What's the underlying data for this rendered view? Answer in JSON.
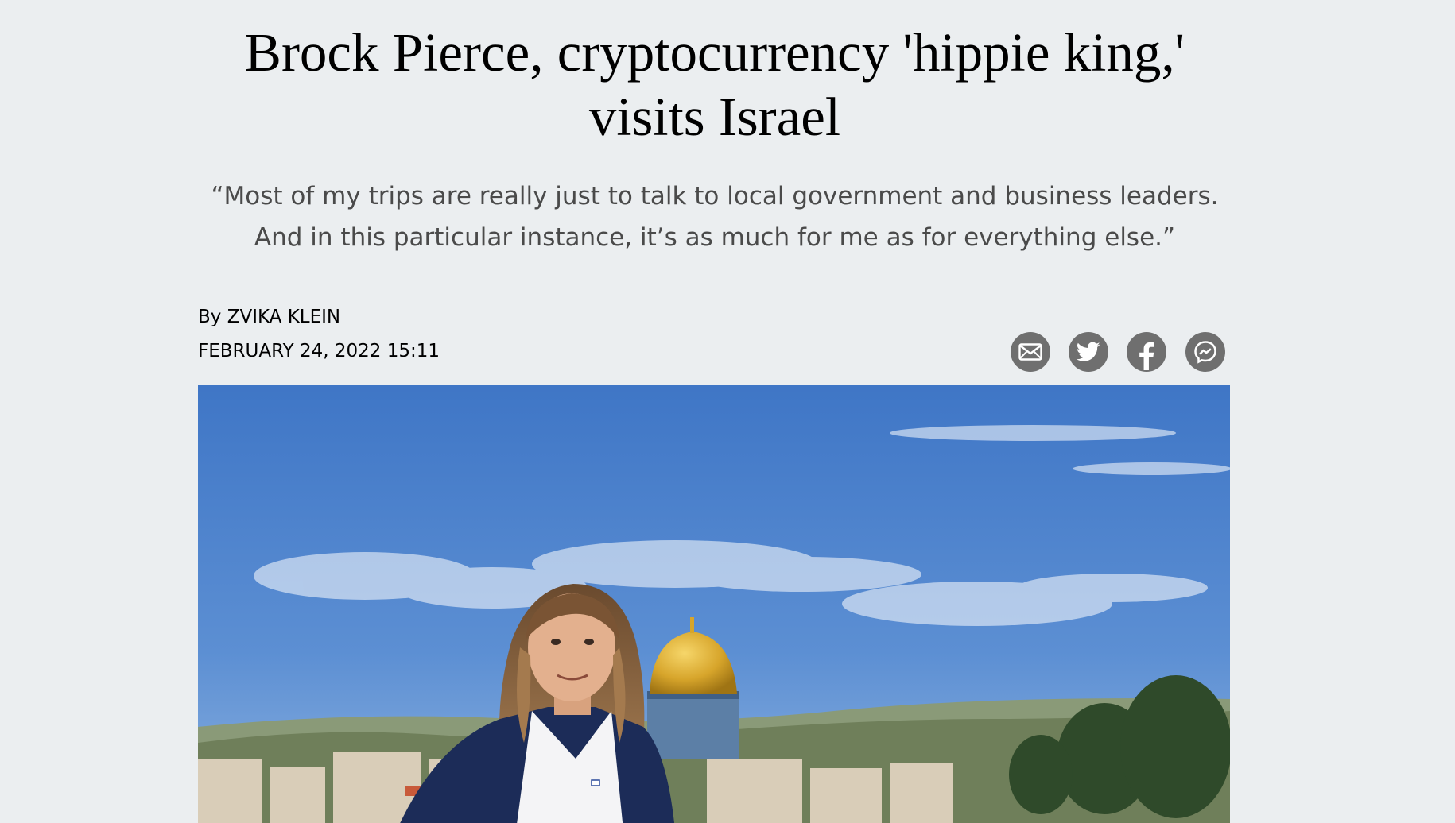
{
  "article": {
    "headline": "Brock Pierce, cryptocurrency 'hippie king,' visits Israel",
    "subheadline": "“Most of my trips are really just to talk to local government and business leaders. And in this particular instance, it’s as much for me as for everything else.”",
    "byline": "By ZVIKA KLEIN",
    "date": "FEBRUARY 24, 2022 15:11"
  },
  "share_buttons": [
    {
      "icon": "mail-icon"
    },
    {
      "icon": "twitter-icon"
    },
    {
      "icon": "facebook-icon"
    },
    {
      "icon": "messenger-icon"
    }
  ],
  "colors": {
    "background": "#ebeef0",
    "share_icon": "#6f6f6f",
    "sky": "#4a80c9",
    "dome": "#d8aa2e"
  }
}
